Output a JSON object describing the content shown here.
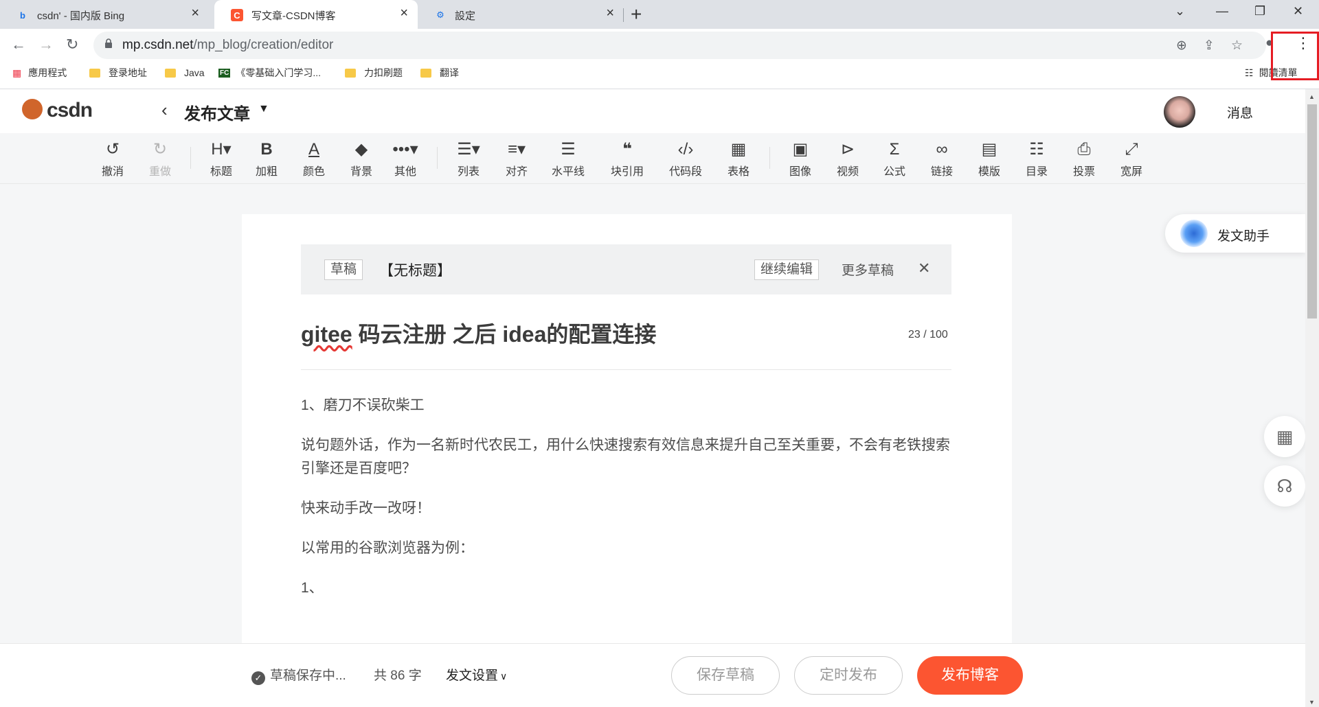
{
  "browser": {
    "tabs": [
      {
        "title": "csdn' - 国内版 Bing",
        "icon": "bing-icon"
      },
      {
        "title": "写文章-CSDN博客",
        "icon": "csdn-icon"
      },
      {
        "title": "設定",
        "icon": "settings-gear-icon"
      }
    ],
    "url_host": "mp.csdn.net",
    "url_path": "/mp_blog/creation/editor",
    "bookmarks": [
      "應用程式",
      "登录地址",
      "Java",
      "《零基础入门学习...",
      "力扣刷题",
      "翻译"
    ],
    "bookmark_fc_badge": "FC",
    "reading_list": "閱讀清單"
  },
  "header": {
    "logo": "csdn",
    "page_title": "发布文章",
    "messages": "消息"
  },
  "toolbar": {
    "undo": "撤消",
    "redo": "重做",
    "heading": "标题",
    "bold": "加粗",
    "color": "颜色",
    "background": "背景",
    "other": "其他",
    "list": "列表",
    "align": "对齐",
    "hr": "水平线",
    "quote": "块引用",
    "code": "代码段",
    "table": "表格",
    "image": "图像",
    "video": "视频",
    "formula": "公式",
    "link": "链接",
    "template": "模版",
    "toc": "目录",
    "vote": "投票",
    "widescreen": "宽屏"
  },
  "draft_bar": {
    "tag": "草稿",
    "title": "【无标题】",
    "continue": "继续编辑",
    "more": "更多草稿"
  },
  "article": {
    "title_word": "gitee",
    "title_rest": " 码云注册 之后 idea的配置连接",
    "count": "23 / 100",
    "paragraphs": [
      "1、磨刀不误砍柴工",
      "说句题外话，作为一名新时代农民工，用什么快速搜索有效信息来提升自己至关重要，不会有老铁搜索引擎还是百度吧？",
      "快来动手改一改呀！",
      "以常用的谷歌浏览器为例：",
      "1、"
    ]
  },
  "helper": {
    "label": "发文助手"
  },
  "footer": {
    "saving": "草稿保存中...",
    "word_count": "共 86 字",
    "settings": "发文设置",
    "save_draft": "保存草稿",
    "schedule": "定时发布",
    "publish": "发布博客"
  },
  "colors": {
    "accent": "#fc5531",
    "highlight_box": "#e51c23"
  }
}
